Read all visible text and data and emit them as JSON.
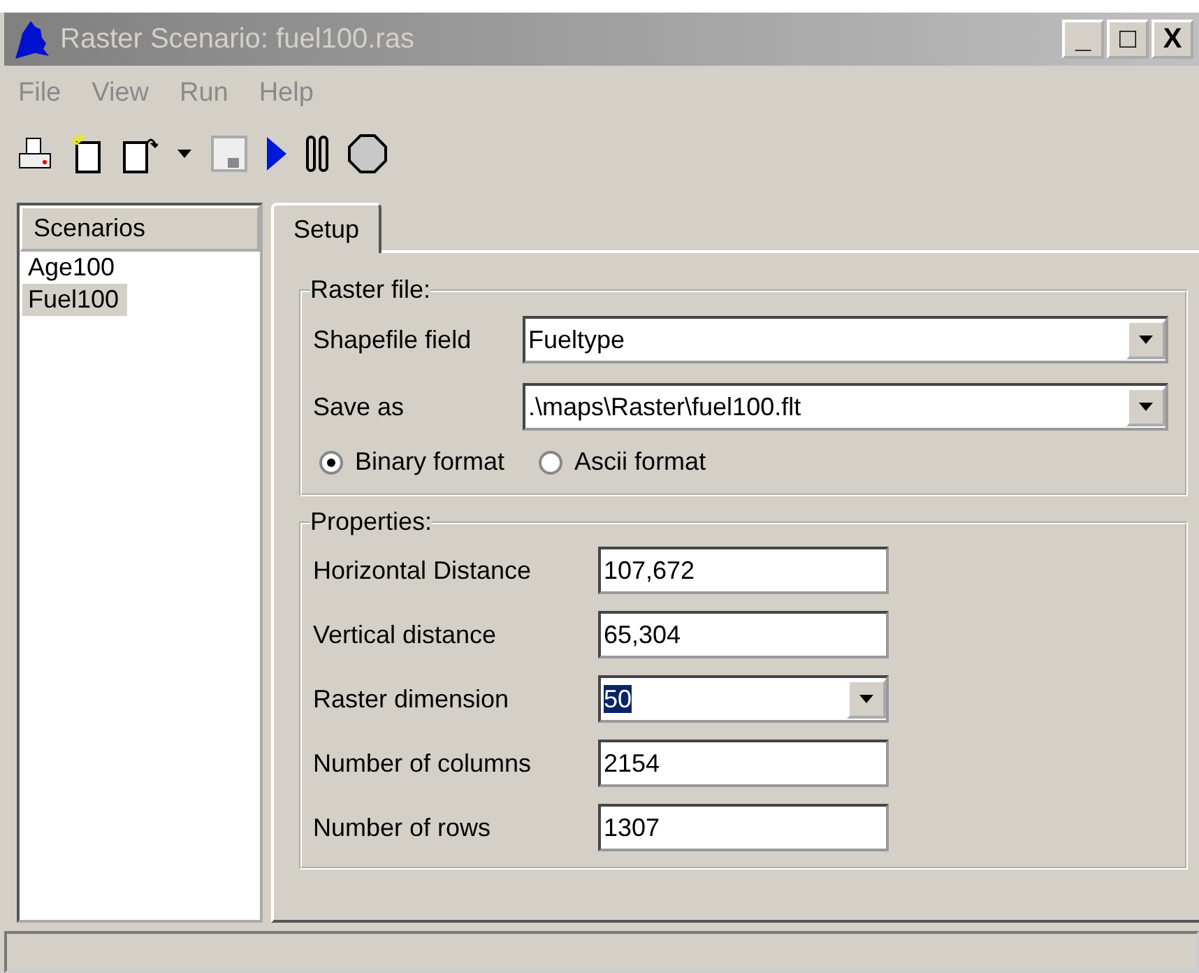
{
  "window": {
    "title": "Raster Scenario: fuel100.ras",
    "controls": [
      "_",
      "□",
      "X"
    ]
  },
  "menu": [
    "File",
    "View",
    "Run",
    "Help"
  ],
  "toolbar": [
    {
      "kind": "print"
    },
    {
      "kind": "new"
    },
    {
      "kind": "open"
    },
    {
      "kind": "dropdown"
    },
    {
      "kind": "save",
      "disabled": true
    },
    {
      "kind": "play"
    },
    {
      "kind": "pause"
    },
    {
      "kind": "stop"
    }
  ],
  "sidebar": {
    "header": "Scenarios",
    "items": [
      {
        "label": "Age100",
        "selected": false
      },
      {
        "label": "Fuel100",
        "selected": true
      }
    ]
  },
  "tabs": [
    {
      "label": "Setup",
      "selected": true
    }
  ],
  "raster_file": {
    "title": "Raster file:",
    "fields": [
      {
        "label": "Shapefile field",
        "value": "Fueltype"
      },
      {
        "label": "Save as",
        "value": ".\\maps\\Raster\\fuel100.flt"
      }
    ],
    "formats": [
      {
        "label": "Binary format",
        "selected": true
      },
      {
        "label": "Ascii format",
        "selected": false
      }
    ]
  },
  "properties": {
    "title": "Properties:",
    "fields": [
      {
        "label": "Horizontal Distance",
        "value": "107,672",
        "kind": "text"
      },
      {
        "label": "Vertical distance",
        "value": "65,304",
        "kind": "text"
      },
      {
        "label": "Raster dimension",
        "value": "50",
        "kind": "combo",
        "highlighted": true
      },
      {
        "label": "Number of columns",
        "value": "2154",
        "kind": "text"
      },
      {
        "label": "Number of rows",
        "value": "1307",
        "kind": "text"
      }
    ]
  }
}
